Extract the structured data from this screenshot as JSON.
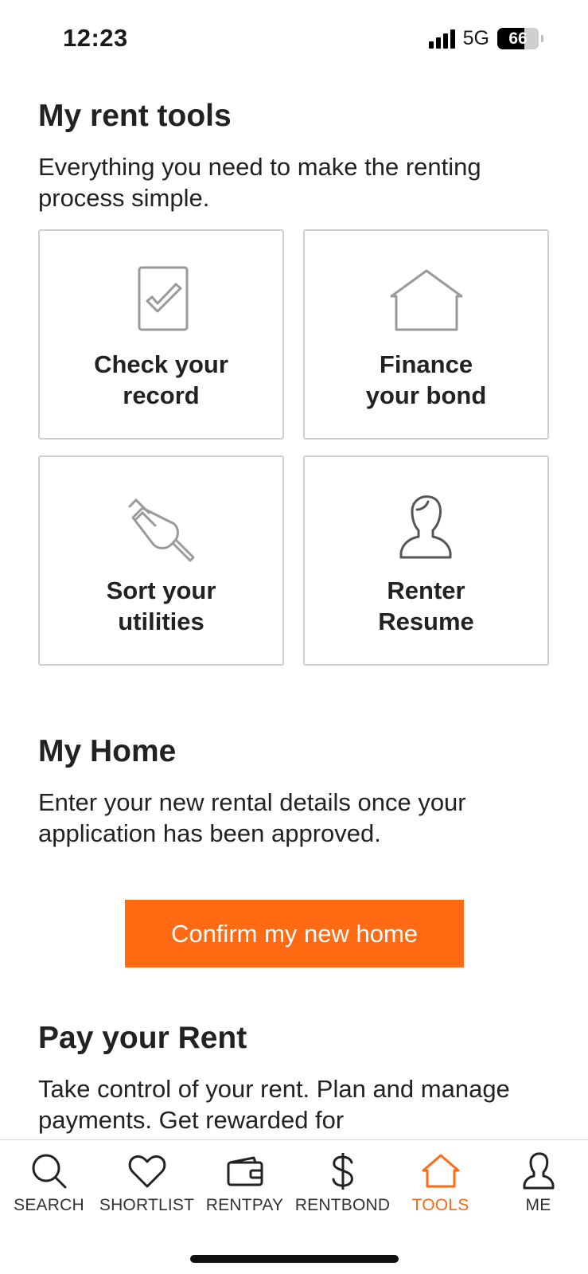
{
  "status_bar": {
    "time": "12:23",
    "network": "5G",
    "battery": "66"
  },
  "rent_tools": {
    "title": "My rent tools",
    "description": "Everything you need to make the renting process simple.",
    "cards": [
      {
        "label": "Check your\nrecord",
        "icon": "checklist-icon"
      },
      {
        "label": "Finance\nyour bond",
        "icon": "house-icon"
      },
      {
        "label": "Sort your\nutilities",
        "icon": "plug-icon"
      },
      {
        "label": "Renter\nResume",
        "icon": "person-icon"
      }
    ]
  },
  "my_home": {
    "title": "My Home",
    "description": "Enter your new rental details once your application has been approved.",
    "button_label": "Confirm my new home"
  },
  "pay_rent": {
    "title": "Pay your Rent",
    "description": "Take control of your rent. Plan and manage payments. Get rewarded for"
  },
  "tab_bar": {
    "tabs": [
      {
        "label": "SEARCH",
        "icon": "search-icon"
      },
      {
        "label": "SHORTLIST",
        "icon": "heart-icon"
      },
      {
        "label": "RENTPAY",
        "icon": "wallet-icon"
      },
      {
        "label": "RENTBOND",
        "icon": "dollar-icon"
      },
      {
        "label": "TOOLS",
        "icon": "house-icon",
        "active": true
      },
      {
        "label": "ME",
        "icon": "person-icon"
      }
    ]
  },
  "colors": {
    "accent": "#ff6a13",
    "text": "#222222",
    "border": "#cfcfcf"
  }
}
